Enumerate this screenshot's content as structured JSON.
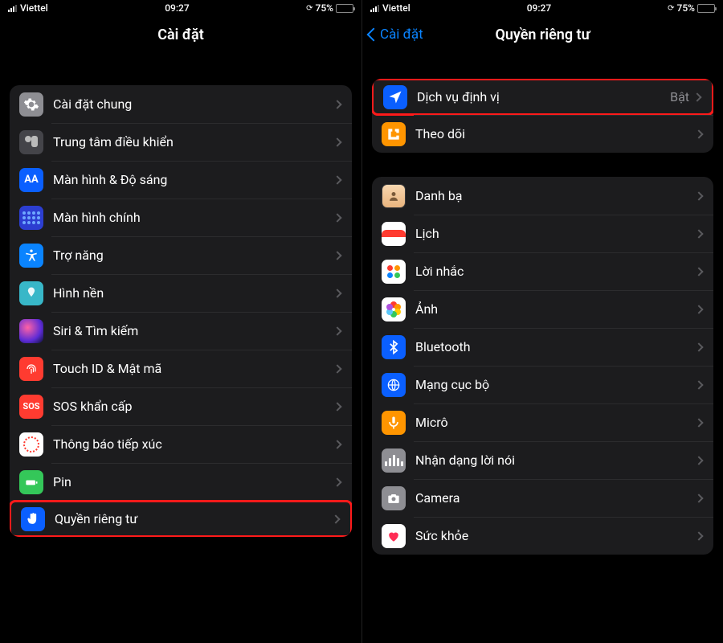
{
  "status": {
    "carrier": "Viettel",
    "time": "09:27",
    "battery_pct": "75%"
  },
  "left": {
    "title": "Cài đặt",
    "items": [
      {
        "k": "general",
        "label": "Cài đặt chung"
      },
      {
        "k": "control",
        "label": "Trung tâm điều khiển"
      },
      {
        "k": "display",
        "label": "Màn hình & Độ sáng"
      },
      {
        "k": "home",
        "label": "Màn hình chính"
      },
      {
        "k": "access",
        "label": "Trợ năng"
      },
      {
        "k": "wall",
        "label": "Hình nền"
      },
      {
        "k": "siri",
        "label": "Siri & Tìm kiếm"
      },
      {
        "k": "touchid",
        "label": "Touch ID & Mật mã"
      },
      {
        "k": "sos",
        "label": "SOS khẩn cấp"
      },
      {
        "k": "expo",
        "label": "Thông báo tiếp xúc"
      },
      {
        "k": "bat",
        "label": "Pin"
      },
      {
        "k": "priv",
        "label": "Quyền riêng tư"
      }
    ]
  },
  "right": {
    "back_label": "Cài đặt",
    "title": "Quyền riêng tư",
    "group1": [
      {
        "k": "loc",
        "label": "Dịch vụ định vị",
        "value": "Bật"
      },
      {
        "k": "track",
        "label": "Theo dõi"
      }
    ],
    "group2": [
      {
        "k": "cont",
        "label": "Danh bạ"
      },
      {
        "k": "cal",
        "label": "Lịch"
      },
      {
        "k": "rem",
        "label": "Lời nhắc"
      },
      {
        "k": "photo",
        "label": "Ảnh"
      },
      {
        "k": "bt",
        "label": "Bluetooth"
      },
      {
        "k": "net",
        "label": "Mạng cục bộ"
      },
      {
        "k": "mic",
        "label": "Micrô"
      },
      {
        "k": "speech",
        "label": "Nhận dạng lời nói"
      },
      {
        "k": "cam",
        "label": "Camera"
      },
      {
        "k": "health",
        "label": "Sức khỏe"
      }
    ]
  },
  "icons": {
    "aa": "AA",
    "sos": "SOS"
  }
}
